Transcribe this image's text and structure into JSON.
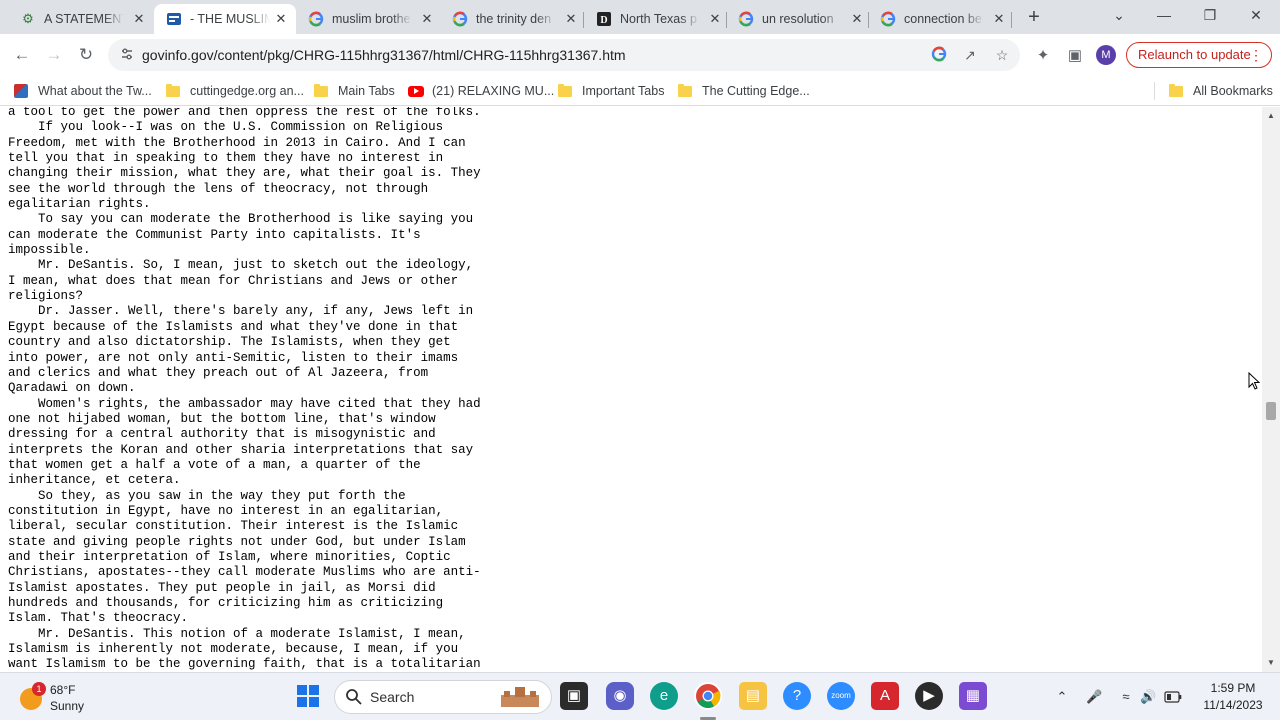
{
  "browser": {
    "tabs": [
      {
        "title": "A STATEMENT",
        "icon": "gear-icon",
        "active": false
      },
      {
        "title": "- THE MUSLIM",
        "icon": "govinfo-icon",
        "active": true
      },
      {
        "title": "muslim brothe",
        "icon": "google-icon",
        "active": false
      },
      {
        "title": "the trinity den",
        "icon": "google-icon",
        "active": false
      },
      {
        "title": "North Texas p",
        "icon": "publication-icon",
        "active": false
      },
      {
        "title": "un resolution",
        "icon": "google-icon",
        "active": false
      },
      {
        "title": "connection be",
        "icon": "google-icon",
        "active": false
      }
    ],
    "url": "govinfo.gov/content/pkg/CHRG-115hhrg31367/html/CHRG-115hhrg31367.htm",
    "profile_initial": "M",
    "relaunch_label": "Relaunch to update",
    "bookmarks": [
      {
        "label": "What about the Tw...",
        "icon": "site-icon"
      },
      {
        "label": "cuttingedge.org an...",
        "icon": "folder-icon"
      },
      {
        "label": "Main Tabs",
        "icon": "folder-icon"
      },
      {
        "label": "(21) RELAXING MU...",
        "icon": "youtube-icon"
      },
      {
        "label": "Important Tabs",
        "icon": "folder-icon"
      },
      {
        "label": "The Cutting Edge...",
        "icon": "folder-icon"
      }
    ],
    "all_bookmarks_label": "All Bookmarks"
  },
  "document": {
    "lines": [
      "a tool to get the power and then oppress the rest of the folks.",
      "    If you look--I was on the U.S. Commission on Religious",
      "Freedom, met with the Brotherhood in 2013 in Cairo. And I can",
      "tell you that in speaking to them they have no interest in",
      "changing their mission, what they are, what their goal is. They",
      "see the world through the lens of theocracy, not through",
      "egalitarian rights.",
      "    To say you can moderate the Brotherhood is like saying you",
      "can moderate the Communist Party into capitalists. It's",
      "impossible.",
      "    Mr. DeSantis. So, I mean, just to sketch out the ideology,",
      "I mean, what does that mean for Christians and Jews or other",
      "religions?",
      "    Dr. Jasser. Well, there's barely any, if any, Jews left in",
      "Egypt because of the Islamists and what they've done in that",
      "country and also dictatorship. The Islamists, when they get",
      "into power, are not only anti-Semitic, listen to their imams",
      "and clerics and what they preach out of Al Jazeera, from",
      "Qaradawi on down.",
      "    Women's rights, the ambassador may have cited that they had",
      "one not hijabed woman, but the bottom line, that's window",
      "dressing for a central authority that is misogynistic and",
      "interprets the Koran and other sharia interpretations that say",
      "that women get a half a vote of a man, a quarter of the",
      "inheritance, et cetera.",
      "    So they, as you saw in the way they put forth the",
      "constitution in Egypt, have no interest in an egalitarian,",
      "liberal, secular constitution. Their interest is the Islamic",
      "state and giving people rights not under God, but under Islam",
      "and their interpretation of Islam, where minorities, Coptic",
      "Christians, apostates--they call moderate Muslims who are anti-",
      "Islamist apostates. They put people in jail, as Morsi did",
      "hundreds and thousands, for criticizing him as criticizing",
      "Islam. That's theocracy.",
      "    Mr. DeSantis. This notion of a moderate Islamist, I mean,",
      "Islamism is inherently not moderate, because, I mean, if you",
      "want Islamism to be the governing faith, that is a totalitarian"
    ]
  },
  "taskbar": {
    "weather_temp": "68°F",
    "weather_cond": "Sunny",
    "weather_badge": "1",
    "search_placeholder": "Search",
    "time": "1:59 PM",
    "date": "11/14/2023"
  }
}
